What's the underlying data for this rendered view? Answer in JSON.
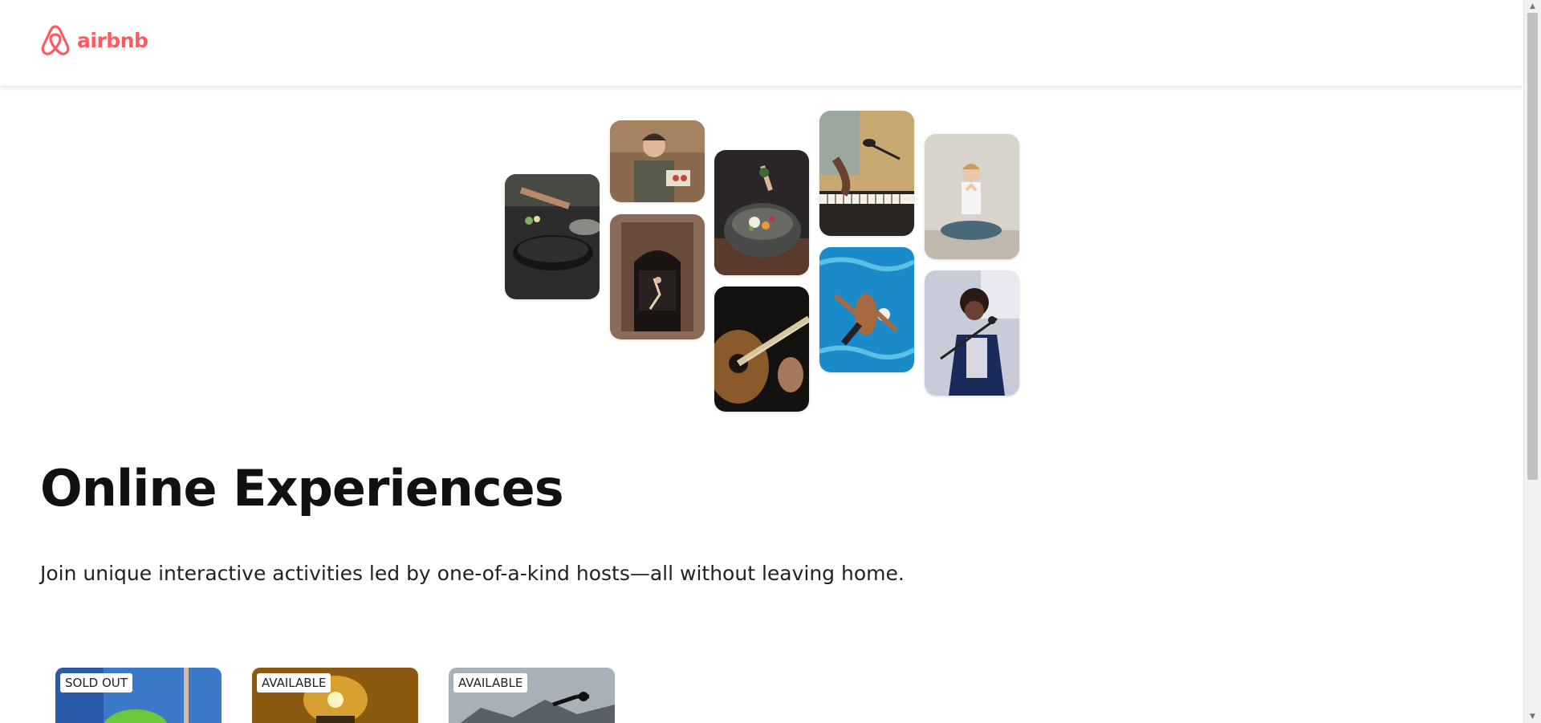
{
  "header": {
    "logo_text": "airbnb",
    "brand_color": "#FF5A5F"
  },
  "hero": {
    "photos": [
      {
        "name": "photo-cooking-pan",
        "icon": "cooking-photo"
      },
      {
        "name": "photo-host-portrait",
        "icon": "portrait-photo"
      },
      {
        "name": "photo-dancer-doorway",
        "icon": "dance-photo"
      },
      {
        "name": "photo-food-bowl",
        "icon": "food-photo"
      },
      {
        "name": "photo-guitar",
        "icon": "guitar-photo"
      },
      {
        "name": "photo-piano-mic",
        "icon": "piano-photo"
      },
      {
        "name": "photo-swimmer",
        "icon": "swim-photo"
      },
      {
        "name": "photo-meditation",
        "icon": "yoga-photo"
      },
      {
        "name": "photo-singer",
        "icon": "singer-photo"
      }
    ]
  },
  "main": {
    "title": "Online Experiences",
    "subtitle": "Join unique interactive activities led by one-of-a-kind hosts—all without leaving home."
  },
  "cards": [
    {
      "badge": "SOLD OUT"
    },
    {
      "badge": "AVAILABLE"
    },
    {
      "badge": "AVAILABLE"
    }
  ]
}
